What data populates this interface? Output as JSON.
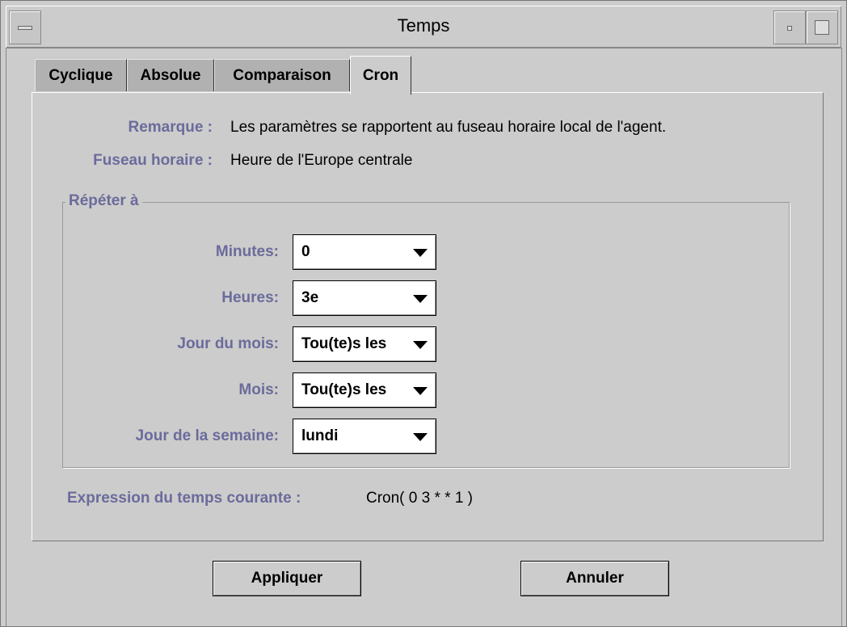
{
  "window": {
    "title": "Temps",
    "icons": {
      "menu": "window-menu-icon",
      "minimize": "minimize-icon",
      "maximize": "maximize-icon"
    }
  },
  "tabs": [
    {
      "label": "Cyclique",
      "active": false
    },
    {
      "label": "Absolue",
      "active": false
    },
    {
      "label": "Comparaison",
      "active": false
    },
    {
      "label": "Cron",
      "active": true
    }
  ],
  "info": {
    "remark_label": "Remarque :",
    "remark_value": "Les paramètres se rapportent au fuseau horaire local de l'agent.",
    "timezone_label": "Fuseau horaire :",
    "timezone_value": "Heure de l'Europe centrale"
  },
  "repeat_group": {
    "legend": "Répéter à",
    "fields": [
      {
        "label": "Minutes:",
        "value": "0"
      },
      {
        "label": "Heures:",
        "value": "3e"
      },
      {
        "label": "Jour du mois:",
        "value": "Tou(te)s les"
      },
      {
        "label": "Mois:",
        "value": "Tou(te)s les"
      },
      {
        "label": "Jour de la semaine:",
        "value": "lundi"
      }
    ]
  },
  "expression": {
    "label": "Expression du temps courante :",
    "value": "Cron( 0 3 * * 1 )"
  },
  "buttons": {
    "apply": "Appliquer",
    "cancel": "Annuler"
  },
  "colors": {
    "label_text": "#6b6b9c",
    "background": "#cccccc",
    "inactive_tab": "#b1b1b1"
  }
}
